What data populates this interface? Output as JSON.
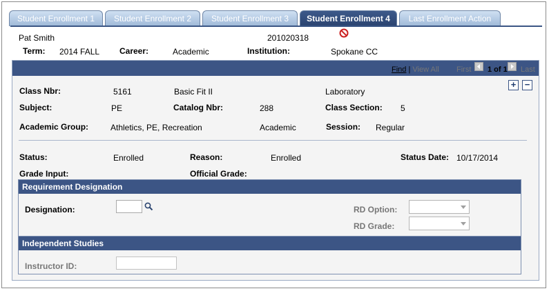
{
  "tabs": [
    {
      "label": "Student Enrollment 1",
      "active": false
    },
    {
      "label": "Student Enrollment 2",
      "active": false
    },
    {
      "label": "Student Enrollment 3",
      "active": false
    },
    {
      "label": "Student Enrollment 4",
      "active": true
    },
    {
      "label": "Last Enrollment Action",
      "active": false
    }
  ],
  "student": {
    "name": "Pat Smith",
    "id": "201020318",
    "term_label": "Term:",
    "term_value": "2014 FALL",
    "career_label": "Career:",
    "career_value": "Academic",
    "institution_label": "Institution:",
    "institution_value": "Spokane CC"
  },
  "nav": {
    "find": "Find",
    "separator": "|",
    "view_all": "View All",
    "first": "First",
    "position": "1 of 1",
    "last": "Last"
  },
  "class_info": {
    "class_nbr_label": "Class Nbr:",
    "class_nbr_value": "5161",
    "course_title": "Basic Fit II",
    "component": "Laboratory",
    "subject_label": "Subject:",
    "subject_value": "PE",
    "catalog_label": "Catalog Nbr:",
    "catalog_value": "288",
    "section_label": "Class Section:",
    "section_value": "5",
    "acad_group_label": "Academic Group:",
    "acad_group_value": "Athletics, PE, Recreation",
    "acad_group_career": "Academic",
    "session_label": "Session:",
    "session_value": "Regular"
  },
  "status_info": {
    "status_label": "Status:",
    "status_value": "Enrolled",
    "reason_label": "Reason:",
    "reason_value": "Enrolled",
    "status_date_label": "Status Date:",
    "status_date_value": "10/17/2014",
    "grade_input_label": "Grade Input:",
    "official_grade_label": "Official Grade:"
  },
  "requirement": {
    "title": "Requirement Designation",
    "designation_label": "Designation:",
    "designation_value": "",
    "rd_option_label": "RD Option:",
    "rd_grade_label": "RD Grade:"
  },
  "independent": {
    "title": "Independent Studies",
    "instructor_label": "Instructor ID:",
    "instructor_value": ""
  },
  "colors": {
    "header_blue": "#3c5585",
    "tab_inactive": "#9fb9d8",
    "stop_red": "#cc2222"
  }
}
